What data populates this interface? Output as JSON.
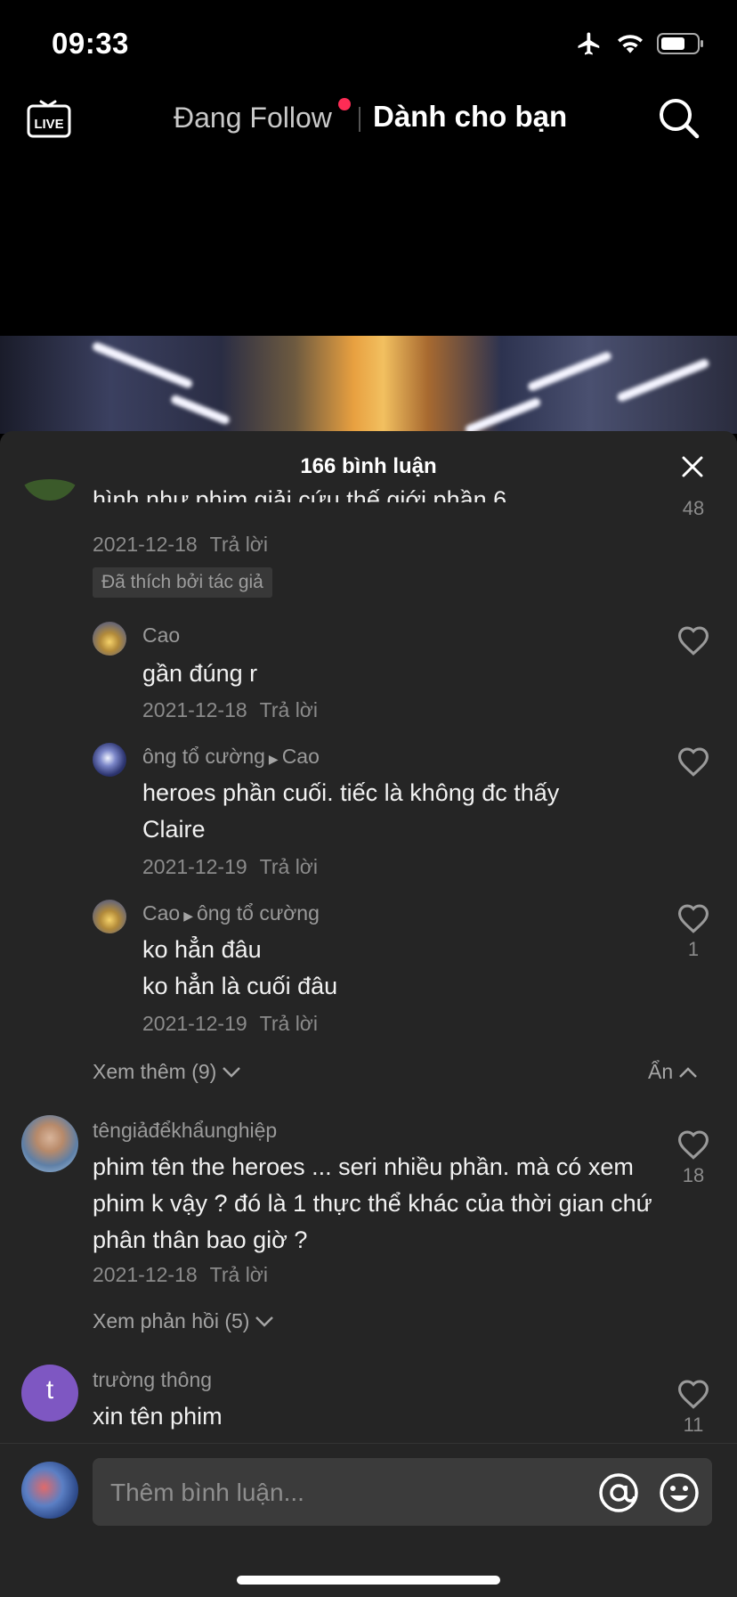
{
  "status_bar": {
    "time": "09:33",
    "icons": [
      "airplane-icon",
      "wifi-icon",
      "battery-icon"
    ]
  },
  "top_nav": {
    "live_label": "LIVE",
    "following_label": "Đang Follow",
    "for_you_label": "Dành cho bạn",
    "notification_dot_color": "#fe2c55"
  },
  "comments": {
    "title": "166 bình luận",
    "reply_label": "Trả lời",
    "items": {
      "c1": {
        "text": "hình như phim giải cứu thế giới phần 6",
        "date": "2021-12-18",
        "likes": "48",
        "badge": "Đã thích bởi tác giả"
      },
      "r1": {
        "user": "Cao",
        "text": "gần đúng r",
        "date": "2021-12-18"
      },
      "r2": {
        "user": "ông tổ cường",
        "reply_to": "Cao",
        "text": "heroes phần cuối. tiếc là không đc thấy Claire",
        "date": "2021-12-19"
      },
      "r3": {
        "user": "Cao",
        "reply_to": "ông tổ cường",
        "line1": "ko hẳn đâu",
        "line2": "ko hẳn là cuối đâu",
        "date": "2021-12-19",
        "likes": "1"
      },
      "c2": {
        "user": "têngiảđểkhẩunghiệp",
        "text": "phim tên the heroes ... seri nhiều phần. mà có xem phim k vậy ? đó là 1 thực thể khác của thời gian chứ phân thân bao giờ ?",
        "date": "2021-12-18",
        "likes": "18"
      },
      "c3": {
        "user": "trường thông",
        "avatar_letter": "t",
        "text": "xin tên phim",
        "likes": "11"
      }
    },
    "view_more": "Xem thêm (9)",
    "hide": "Ẩn",
    "view_replies": "Xem phản hồi (5)"
  },
  "composer": {
    "placeholder": "Thêm bình luận..."
  }
}
